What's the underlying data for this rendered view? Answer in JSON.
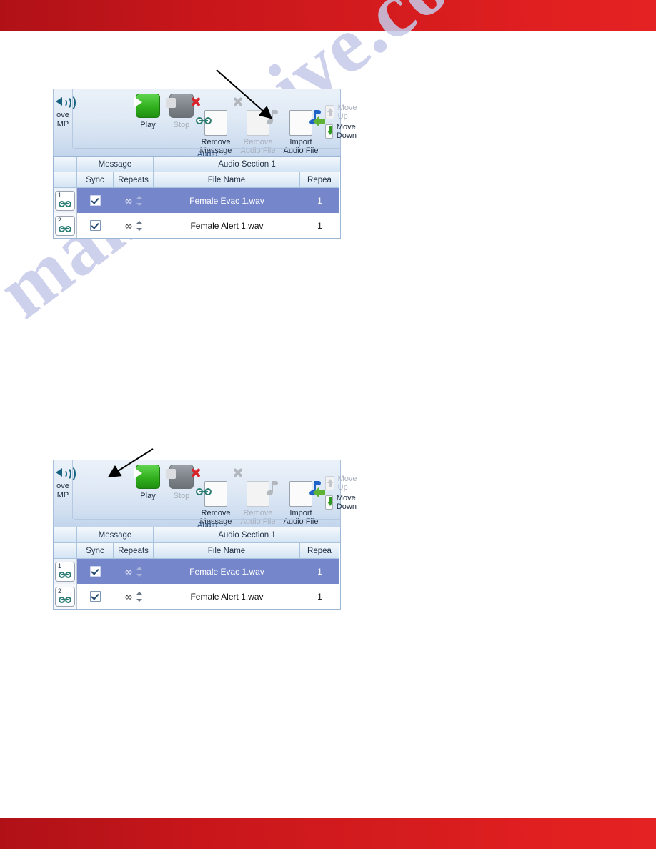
{
  "page": {
    "watermark_text": "manualshive.com",
    "top_bar_color": "#c8161b",
    "bottom_bar_color": "#c8161b"
  },
  "panels": [
    {
      "id": "panel-top",
      "ribbon": {
        "group_label": "Audio",
        "partial_left_button": {
          "line1": "ove",
          "line2": "MP",
          "icon": "speaker-icon"
        },
        "buttons": [
          {
            "name": "play",
            "label": "Play",
            "icon": "play-icon",
            "enabled": true
          },
          {
            "name": "stop",
            "label": "Stop",
            "icon": "stop-icon",
            "enabled": false
          },
          {
            "name": "remove-message",
            "label": "Remove\nMessage",
            "icon": "remove-message-icon",
            "enabled": true
          },
          {
            "name": "remove-audio-file",
            "label": "Remove\nAudio File",
            "icon": "remove-audio-icon",
            "enabled": false
          },
          {
            "name": "import-audio-file",
            "label": "Import\nAudio File",
            "icon": "import-audio-icon",
            "enabled": true
          }
        ],
        "small_buttons": [
          {
            "name": "move-up",
            "label": "Move Up",
            "icon": "move-up-icon",
            "enabled": false
          },
          {
            "name": "move-down",
            "label": "Move Down",
            "icon": "move-down-icon",
            "enabled": true
          }
        ]
      },
      "grid": {
        "group_headers": [
          {
            "label": "",
            "span": "icon"
          },
          {
            "label": "Message",
            "span": "message"
          },
          {
            "label": "Audio Section 1",
            "span": "audio"
          }
        ],
        "columns": [
          "",
          "Sync",
          "Repeats",
          "File Name",
          "Repea"
        ],
        "rows": [
          {
            "number": "1",
            "sync": true,
            "repeats": "∞",
            "file_name": "Female Evac 1.wav",
            "audio_repeats": "1",
            "selected": true
          },
          {
            "number": "2",
            "sync": true,
            "repeats": "∞",
            "file_name": "Female Alert 1.wav",
            "audio_repeats": "1",
            "selected": false
          }
        ]
      },
      "annotation": {
        "name": "callout-arrow-import-audio",
        "points_to": "import-audio-file"
      }
    },
    {
      "id": "panel-bottom",
      "ribbon": {
        "group_label": "Audio",
        "partial_left_button": {
          "line1": "ove",
          "line2": "MP",
          "icon": "speaker-icon"
        },
        "buttons": [
          {
            "name": "play",
            "label": "Play",
            "icon": "play-icon",
            "enabled": true
          },
          {
            "name": "stop",
            "label": "Stop",
            "icon": "stop-icon",
            "enabled": false
          },
          {
            "name": "remove-message",
            "label": "Remove\nMessage",
            "icon": "remove-message-icon",
            "enabled": true
          },
          {
            "name": "remove-audio-file",
            "label": "Remove\nAudio File",
            "icon": "remove-audio-icon",
            "enabled": false
          },
          {
            "name": "import-audio-file",
            "label": "Import\nAudio File",
            "icon": "import-audio-icon",
            "enabled": true
          }
        ],
        "small_buttons": [
          {
            "name": "move-up",
            "label": "Move Up",
            "icon": "move-up-icon",
            "enabled": false
          },
          {
            "name": "move-down",
            "label": "Move Down",
            "icon": "move-down-icon",
            "enabled": true
          }
        ]
      },
      "grid": {
        "group_headers": [
          {
            "label": "",
            "span": "icon"
          },
          {
            "label": "Message",
            "span": "message"
          },
          {
            "label": "Audio Section 1",
            "span": "audio"
          }
        ],
        "columns": [
          "",
          "Sync",
          "Repeats",
          "File Name",
          "Repea"
        ],
        "rows": [
          {
            "number": "1",
            "sync": true,
            "repeats": "∞",
            "file_name": "Female Evac 1.wav",
            "audio_repeats": "1",
            "selected": true
          },
          {
            "number": "2",
            "sync": true,
            "repeats": "∞",
            "file_name": "Female Alert 1.wav",
            "audio_repeats": "1",
            "selected": false
          }
        ]
      },
      "annotation": {
        "name": "callout-arrow-play",
        "points_to": "play"
      }
    }
  ]
}
